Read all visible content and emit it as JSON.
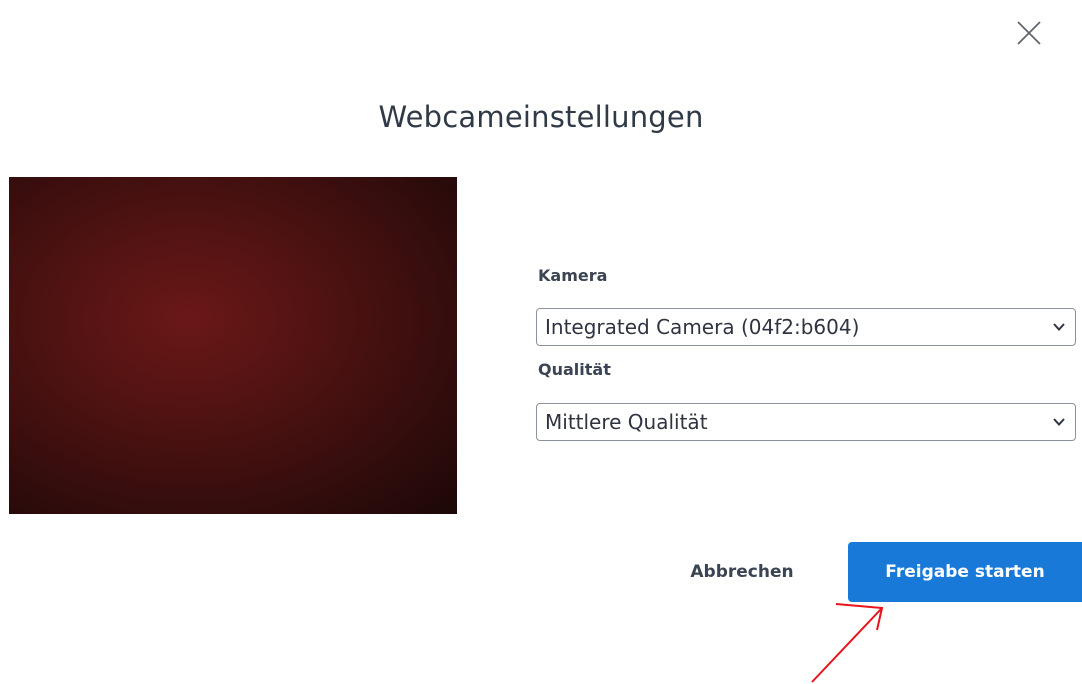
{
  "dialog": {
    "title": "Webcameinstellungen"
  },
  "camera": {
    "label": "Kamera",
    "selected": "Integrated Camera (04f2:b604)"
  },
  "quality": {
    "label": "Qualität",
    "selected": "Mittlere Qualität"
  },
  "actions": {
    "cancel_label": "Abbrechen",
    "start_label": "Freigabe starten"
  },
  "icons": {
    "close": "close-icon",
    "dropdown": "chevron-down-icon"
  },
  "colors": {
    "primary": "#1979d9",
    "annotation": "#e8141b",
    "preview": "#5a1514"
  }
}
